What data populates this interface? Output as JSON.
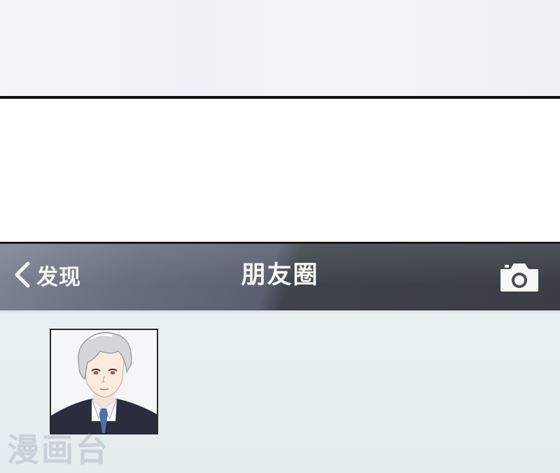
{
  "nav": {
    "back_label": "发现",
    "title": "朋友圈",
    "camera_icon": "camera-icon",
    "back_icon": "chevron-left-icon"
  },
  "watermark": "漫画台",
  "colors": {
    "nav_bg_light": "#6b7282",
    "nav_bg_dark": "#3a3d44",
    "nav_text": "#f7f7f7",
    "screen_bg": "#e7eef2"
  }
}
